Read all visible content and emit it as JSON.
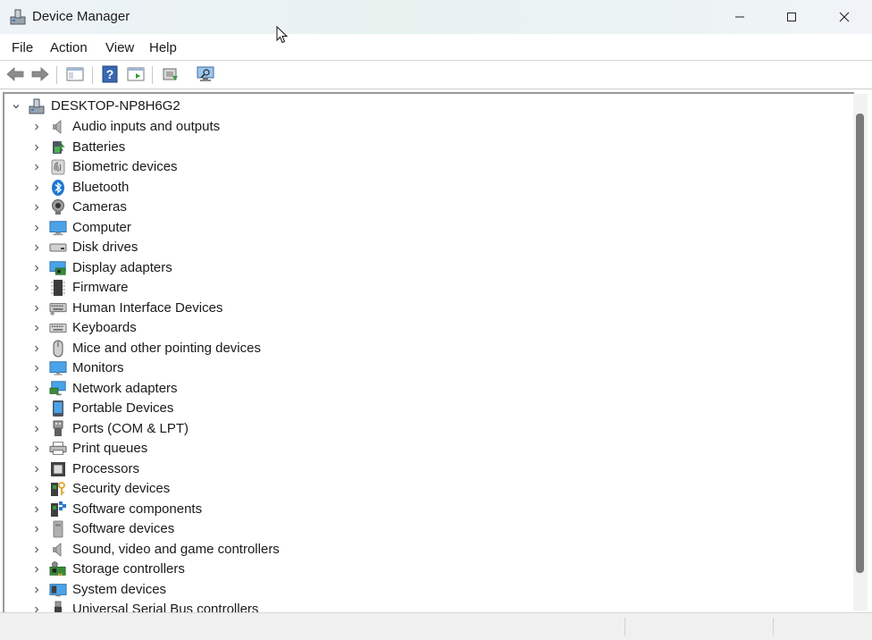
{
  "window": {
    "title": "Device Manager",
    "icon": "device-manager-icon"
  },
  "menu": {
    "items": [
      "File",
      "Action",
      "View",
      "Help"
    ]
  },
  "toolbar": {
    "buttons": [
      "back-icon",
      "forward-icon",
      "show-hide-console-tree-icon",
      "help-icon",
      "action-pane-icon",
      "update-driver-icon",
      "scan-hardware-icon"
    ]
  },
  "tree": {
    "root": "DESKTOP-NP8H6G2",
    "categories": [
      {
        "label": "Audio inputs and outputs",
        "icon": "speaker-icon"
      },
      {
        "label": "Batteries",
        "icon": "battery-icon"
      },
      {
        "label": "Biometric devices",
        "icon": "fingerprint-icon"
      },
      {
        "label": "Bluetooth",
        "icon": "bluetooth-icon"
      },
      {
        "label": "Cameras",
        "icon": "camera-icon"
      },
      {
        "label": "Computer",
        "icon": "computer-icon"
      },
      {
        "label": "Disk drives",
        "icon": "disk-drive-icon"
      },
      {
        "label": "Display adapters",
        "icon": "display-adapter-icon"
      },
      {
        "label": "Firmware",
        "icon": "firmware-icon"
      },
      {
        "label": "Human Interface Devices",
        "icon": "hid-icon"
      },
      {
        "label": "Keyboards",
        "icon": "keyboard-icon"
      },
      {
        "label": "Mice and other pointing devices",
        "icon": "mouse-icon"
      },
      {
        "label": "Monitors",
        "icon": "monitor-icon"
      },
      {
        "label": "Network adapters",
        "icon": "network-adapter-icon"
      },
      {
        "label": "Portable Devices",
        "icon": "portable-device-icon"
      },
      {
        "label": "Ports (COM & LPT)",
        "icon": "port-icon"
      },
      {
        "label": "Print queues",
        "icon": "printer-icon"
      },
      {
        "label": "Processors",
        "icon": "processor-icon"
      },
      {
        "label": "Security devices",
        "icon": "security-device-icon"
      },
      {
        "label": "Software components",
        "icon": "software-component-icon"
      },
      {
        "label": "Software devices",
        "icon": "software-device-icon"
      },
      {
        "label": "Sound, video and game controllers",
        "icon": "sound-controller-icon"
      },
      {
        "label": "Storage controllers",
        "icon": "storage-controller-icon"
      },
      {
        "label": "System devices",
        "icon": "system-device-icon"
      },
      {
        "label": "Universal Serial Bus controllers",
        "icon": "usb-icon"
      }
    ]
  },
  "colors": {
    "accent": "#2b79d0",
    "scroll_thumb": "#7a7a7a"
  }
}
